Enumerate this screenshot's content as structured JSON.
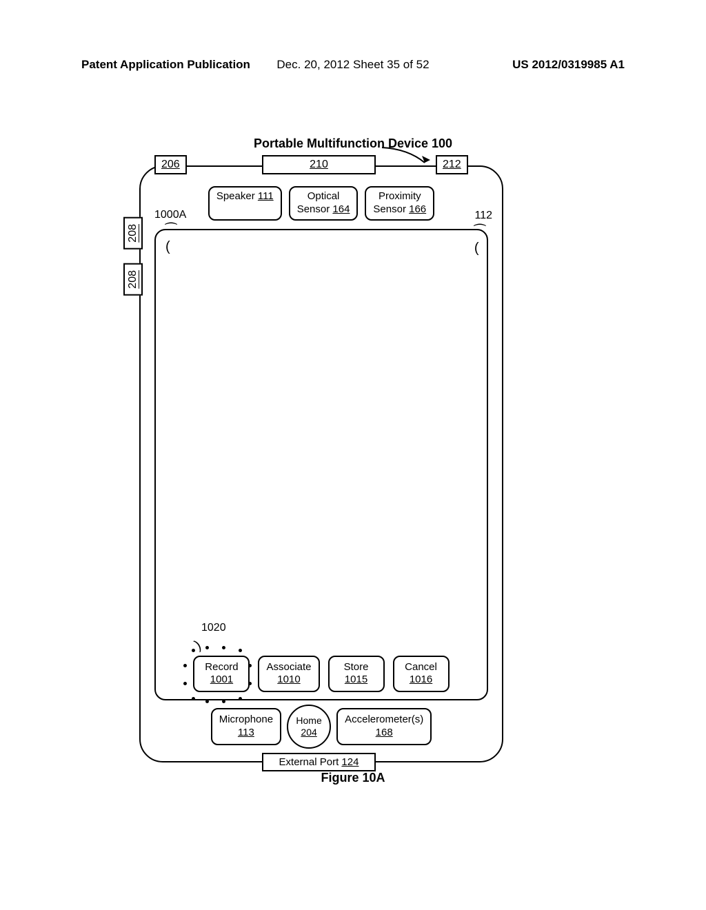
{
  "page_header": {
    "left": "Patent Application Publication",
    "center": "Dec. 20, 2012  Sheet 35 of 52",
    "right": "US 2012/0319985 A1"
  },
  "figure_title": "Portable Multifunction Device 100",
  "top_labels": {
    "l206": "206",
    "l210": "210",
    "l212": "212"
  },
  "side_labels": {
    "a": "208",
    "b": "208"
  },
  "sensors": {
    "speaker": {
      "name": "Speaker",
      "num": "111"
    },
    "optical": {
      "line1": "Optical",
      "line2": "Sensor",
      "num": "164"
    },
    "proximity": {
      "line1": "Proximity",
      "line2": "Sensor",
      "num": "166"
    }
  },
  "corner_labels": {
    "left": "1000A",
    "right": "112"
  },
  "contact_label": "1020",
  "buttons": {
    "record": {
      "name": "Record",
      "num": "1001"
    },
    "associate": {
      "name": "Associate",
      "num": "1010"
    },
    "store": {
      "name": "Store",
      "num": "1015"
    },
    "cancel": {
      "name": "Cancel",
      "num": "1016"
    }
  },
  "hardware": {
    "mic": {
      "name": "Microphone",
      "num": "113"
    },
    "home": {
      "name": "Home",
      "num": "204"
    },
    "accel": {
      "name": "Accelerometer(s)",
      "num": "168"
    }
  },
  "external_port": {
    "name": "External Port",
    "num": "124"
  },
  "figure_caption": "Figure 10A"
}
